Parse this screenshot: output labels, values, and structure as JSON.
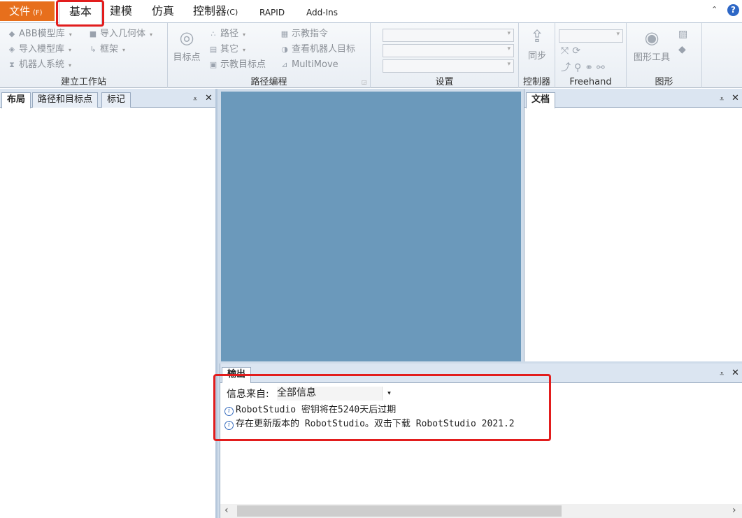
{
  "menubar": {
    "file": {
      "label": "文件",
      "accel": "(F)"
    },
    "tabs": [
      {
        "label": "基本",
        "accel": ""
      },
      {
        "label": "建模",
        "accel": ""
      },
      {
        "label": "仿真",
        "accel": ""
      },
      {
        "label": "控制器",
        "accel": "(C)"
      },
      {
        "label": "RAPID",
        "accel": ""
      },
      {
        "label": "Add-Ins",
        "accel": ""
      }
    ],
    "help": "?"
  },
  "ribbon": {
    "build_station": {
      "label": "建立工作站",
      "abb_library": "ABB模型库",
      "import_library": "导入模型库",
      "robot_system": "机器人系统",
      "import_geometry": "导入几何体",
      "frame": "框架"
    },
    "path_programming": {
      "label": "路径编程",
      "target": "目标点",
      "path": "路径",
      "other": "其它",
      "teach_target": "示教目标点",
      "teach_instruction": "示教指令",
      "view_robot_target": "查看机器人目标",
      "multimove": "MultiMove"
    },
    "settings": {
      "label": "设置"
    },
    "controller": {
      "label": "控制器",
      "sync": "同步"
    },
    "freehand": {
      "label": "Freehand"
    },
    "graphics": {
      "label": "图形",
      "graphics_tools": "图形工具"
    }
  },
  "left_panel": {
    "tabs": [
      "布局",
      "路径和目标点",
      "标记"
    ]
  },
  "doc_panel": {
    "title": "文档"
  },
  "output": {
    "title": "输出",
    "filter_label": "信息来自:",
    "filter_value": "全部信息",
    "messages": [
      "RobotStudio 密钥将在5240天后过期",
      "存在更新版本的 RobotStudio。双击下载 RobotStudio 2021.2"
    ]
  },
  "colors": {
    "file_tab": "#e76f1c",
    "viewport": "#6b99bb",
    "highlight": "#e21d1d",
    "help_icon": "#2d67c6"
  }
}
